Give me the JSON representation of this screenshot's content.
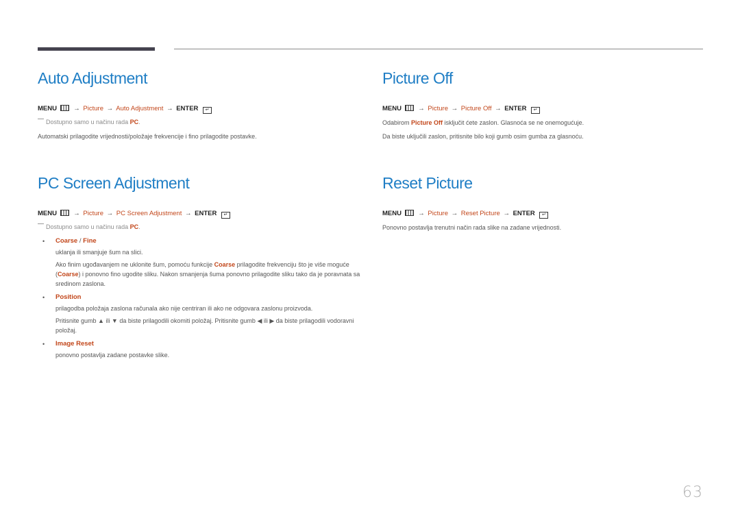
{
  "sections": {
    "auto_adjustment": {
      "title": "Auto Adjustment",
      "menu": {
        "menu_label": "MENU",
        "arrow": "→",
        "picture": "Picture",
        "item": "Auto Adjustment",
        "enter_label": "ENTER"
      },
      "note": {
        "prefix": "Dostupno samo u načinu rada ",
        "highlight": "PC",
        "suffix": "."
      },
      "description": "Automatski prilagodite vrijednosti/položaje frekvencije i fino prilagodite postavke."
    },
    "picture_off": {
      "title": "Picture Off",
      "menu": {
        "menu_label": "MENU",
        "arrow": "→",
        "picture": "Picture",
        "item": "Picture Off",
        "enter_label": "ENTER"
      },
      "line1": {
        "prefix": "Odabirom ",
        "highlight": "Picture Off",
        "suffix": " isključit ćete zaslon. Glasnoća se ne onemogućuje."
      },
      "line2": "Da biste uključili zaslon, pritisnite bilo koji gumb osim gumba za glasnoću."
    },
    "pc_screen_adjustment": {
      "title": "PC Screen Adjustment",
      "menu": {
        "menu_label": "MENU",
        "arrow": "→",
        "picture": "Picture",
        "item": "PC Screen Adjustment",
        "enter_label": "ENTER"
      },
      "note": {
        "prefix": "Dostupno samo u načinu rada ",
        "highlight": "PC",
        "suffix": "."
      },
      "items": [
        {
          "bullet": "•",
          "title_a": "Coarse",
          "sep": " / ",
          "title_b": "Fine",
          "desc": "uklanja ili smanjuje šum na slici.",
          "detail": {
            "p1": "Ako finim ugođavanjem ne uklonite šum, pomoću funkcije ",
            "h1": "Coarse",
            "p2": " prilagodite frekvenciju što je više moguće (",
            "h2": "Coarse",
            "p3": ") i ponovno fino ugodite sliku. Nakon smanjenja šuma ponovno prilagodite sliku tako da je poravnata sa sredinom zaslona."
          }
        },
        {
          "bullet": "•",
          "title": "Position",
          "desc": "prilagodba položaja zaslona računala ako nije centriran ili ako ne odgovara zaslonu proizvoda.",
          "detail": "Pritisnite gumb ▲ ili ▼ da biste prilagodili okomiti položaj. Pritisnite gumb ◀ ili ▶ da biste prilagodili vodoravni položaj."
        },
        {
          "bullet": "•",
          "title": "Image Reset",
          "desc": "ponovno postavlja zadane postavke slike."
        }
      ]
    },
    "reset_picture": {
      "title": "Reset Picture",
      "menu": {
        "menu_label": "MENU",
        "arrow": "→",
        "picture": "Picture",
        "item": "Reset Picture",
        "enter_label": "ENTER"
      },
      "description": "Ponovno postavlja trenutni način rada slike na zadane vrijednosti."
    }
  },
  "icons": {
    "menu_icon": "menu-grid-icon",
    "enter_icon": "enter-return-icon",
    "enter_glyph": "↵"
  },
  "page_number": "63",
  "colors": {
    "heading": "#1f7ec5",
    "highlight": "#c2461a",
    "body_text": "#555555",
    "note_text": "#8c8c8c",
    "top_bar": "#45434f"
  }
}
